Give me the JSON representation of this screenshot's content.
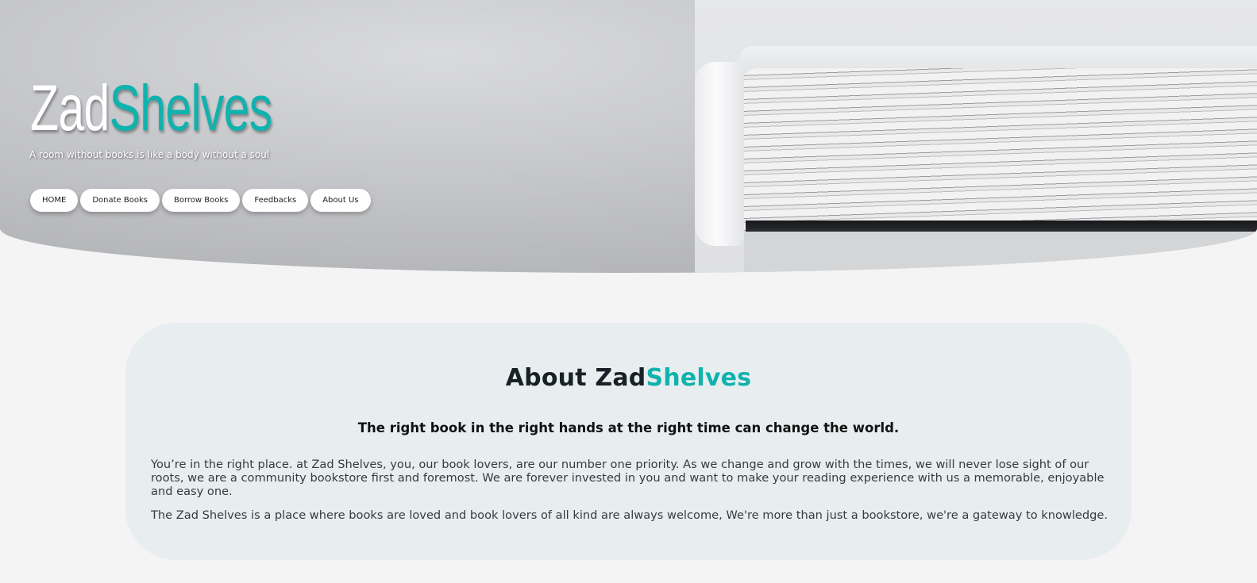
{
  "header": {
    "brand_part1": "Zad",
    "brand_part2": "Shelves",
    "tagline": "A room without books is like a body without a soul",
    "nav": [
      "HOME",
      "Donate Books",
      "Borrow Books",
      "Feedbacks",
      "About Us"
    ]
  },
  "about": {
    "title_part1": "About Zad",
    "title_part2": "Shelves",
    "subtitle": "The right book in the right hands at the right time can change the world.",
    "paragraph1": "You’re in the right place. at Zad Shelves, you, our book lovers, are our number one priority. As we change and grow with the times, we will never lose sight of our roots, we are a community bookstore first and foremost. We are forever invested in you and want to make your reading experience with us a memorable, enjoyable and easy one.",
    "paragraph2": "The Zad Shelves is a place where books are loved and book lovers of all kind are always welcome, We're more than just a bookstore, we're a gateway to knowledge."
  },
  "colors": {
    "accent": "#10b2ad",
    "page_background": "#f4f4f4",
    "card_background": "#e8eef0"
  }
}
